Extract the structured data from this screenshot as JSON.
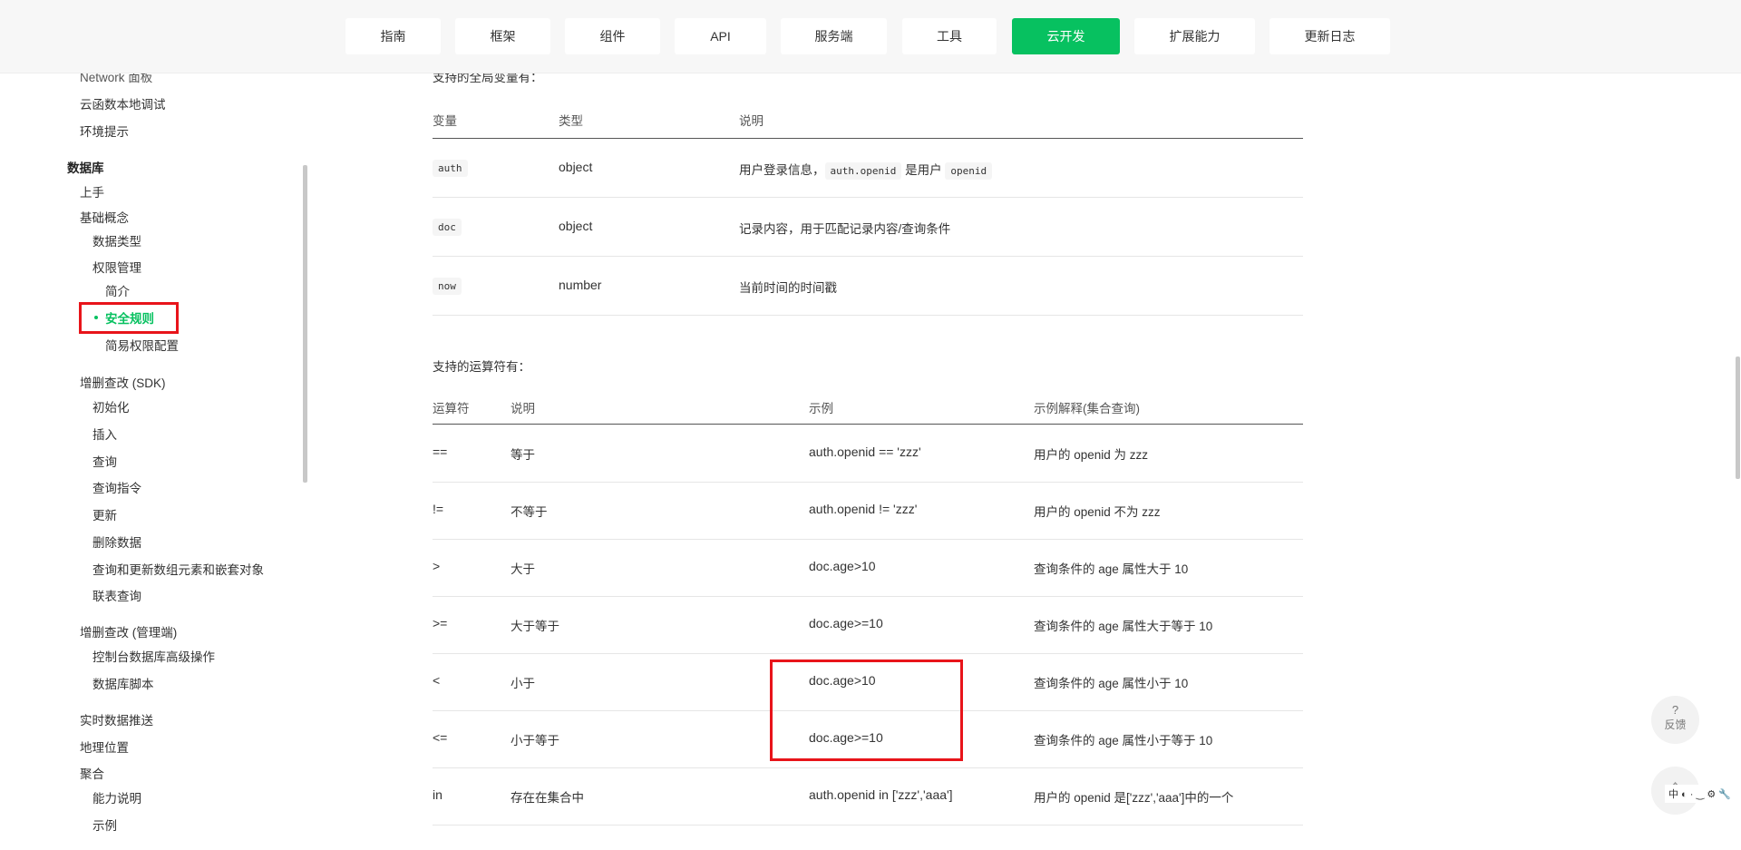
{
  "nav": {
    "items": [
      "指南",
      "框架",
      "组件",
      "API",
      "服务端",
      "工具",
      "云开发",
      "扩展能力",
      "更新日志"
    ],
    "active_index": 6,
    "accent_color": "#07c160"
  },
  "sidebar": {
    "items": [
      {
        "label": "Network 面板"
      },
      {
        "label": "云函数本地调试"
      },
      {
        "label": "环境提示"
      },
      {
        "label": "数据库"
      },
      {
        "label": "上手"
      },
      {
        "label": "基础概念"
      },
      {
        "label": "数据类型"
      },
      {
        "label": "权限管理"
      },
      {
        "label": "简介"
      },
      {
        "label": "安全规则"
      },
      {
        "label": "简易权限配置"
      },
      {
        "label": "增删查改 (SDK)"
      },
      {
        "label": "初始化"
      },
      {
        "label": "插入"
      },
      {
        "label": "查询"
      },
      {
        "label": "查询指令"
      },
      {
        "label": "更新"
      },
      {
        "label": "删除数据"
      },
      {
        "label": "查询和更新数组元素和嵌套对象"
      },
      {
        "label": "联表查询"
      },
      {
        "label": "增删查改 (管理端)"
      },
      {
        "label": "控制台数据库高级操作"
      },
      {
        "label": "数据库脚本"
      },
      {
        "label": "实时数据推送"
      },
      {
        "label": "地理位置"
      },
      {
        "label": "聚合"
      },
      {
        "label": "能力说明"
      },
      {
        "label": "示例"
      }
    ],
    "active_label": "安全规则"
  },
  "content": {
    "globals_intro": "支持的全局变量有：",
    "globals_headers": [
      "变量",
      "类型",
      "说明"
    ],
    "globals_rows": [
      {
        "var": "auth",
        "type": "object",
        "desc_pre": "用户登录信息，",
        "code1": "auth.openid",
        "desc_mid": " 是用户 ",
        "code2": "openid"
      },
      {
        "var": "doc",
        "type": "object",
        "desc": "记录内容，用于匹配记录内容/查询条件"
      },
      {
        "var": "now",
        "type": "number",
        "desc": "当前时间的时间戳"
      }
    ],
    "ops_intro": "支持的运算符有：",
    "ops_headers": [
      "运算符",
      "说明",
      "示例",
      "示例解释(集合查询)"
    ],
    "ops_rows": [
      {
        "op": "==",
        "desc": "等于",
        "example": "auth.openid == 'zzz'",
        "explain": "用户的 openid 为 zzz"
      },
      {
        "op": "!=",
        "desc": "不等于",
        "example": "auth.openid != 'zzz'",
        "explain": "用户的 openid 不为 zzz"
      },
      {
        "op": ">",
        "desc": "大于",
        "example": "doc.age>10",
        "explain": "查询条件的 age 属性大于 10"
      },
      {
        "op": ">=",
        "desc": "大于等于",
        "example": "doc.age>=10",
        "explain": "查询条件的 age 属性大于等于 10"
      },
      {
        "op": "<",
        "desc": "小于",
        "example": "doc.age>10",
        "explain": "查询条件的 age 属性小于 10"
      },
      {
        "op": "<=",
        "desc": "小于等于",
        "example": "doc.age>=10",
        "explain": "查询条件的 age 属性小于等于 10"
      },
      {
        "op": "in",
        "desc": "存在在集合中",
        "example": "auth.openid in ['zzz','aaa']",
        "explain": "用户的 openid 是['zzz','aaa']中的一个"
      }
    ]
  },
  "floating": {
    "feedback_icon": "?",
    "feedback_label": "反馈",
    "totop_icon": "arrow-up-icon",
    "ime_text": "中 ◐ · ‿ ⚙ 🔧"
  }
}
